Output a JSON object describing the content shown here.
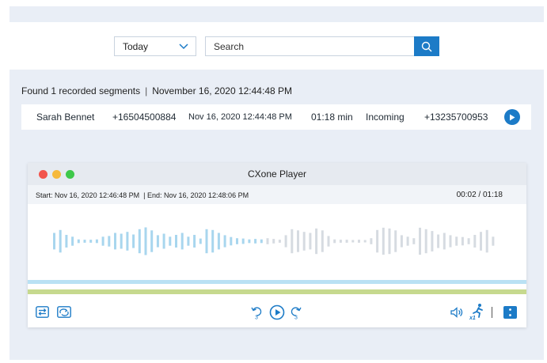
{
  "search": {
    "date_value": "Today",
    "placeholder": "Search"
  },
  "results": {
    "summary": "Found 1 recorded segments",
    "summary_time": "November 16, 2020 12:44:48 PM",
    "row": {
      "agent": "Sarah Bennet",
      "ani": "+16504500884",
      "datetime": "Nov 16, 2020 12:44:48 PM",
      "duration": "01:18 min",
      "direction": "Incoming",
      "dnis": "+13235700953"
    }
  },
  "player": {
    "title": "CXone Player",
    "start_label": "Start:",
    "start_value": "Nov 16, 2020 12:46:48 PM",
    "end_label": "End:",
    "end_value": "Nov 16, 2020 12:48:06 PM",
    "time_readout": "00:02 / 01:18",
    "skip_back_label": "3",
    "skip_forward_label": "3",
    "speed_label": "x1",
    "progress_fraction": 0.48
  },
  "colors": {
    "accent": "#1c7bc7",
    "wave_played": "#a8d6ee",
    "wave_unplayed": "#d6dbe1",
    "timeline_blue": "#b9e1f4",
    "timeline_green": "#c6d98e",
    "mac_red": "#f2544c",
    "mac_yellow": "#f6b93b",
    "mac_green": "#3ec84a"
  },
  "icons": {
    "search": "search-icon",
    "dropdown": "chevron-down-icon",
    "row_play": "play-circle-icon",
    "swap": "swap-channels-icon",
    "loop": "loop-icon",
    "rewind": "rewind-3-icon",
    "play": "play-icon",
    "forward": "forward-3-icon",
    "volume": "volume-icon",
    "speed": "playback-speed-icon",
    "more": "more-vertical-icon"
  }
}
